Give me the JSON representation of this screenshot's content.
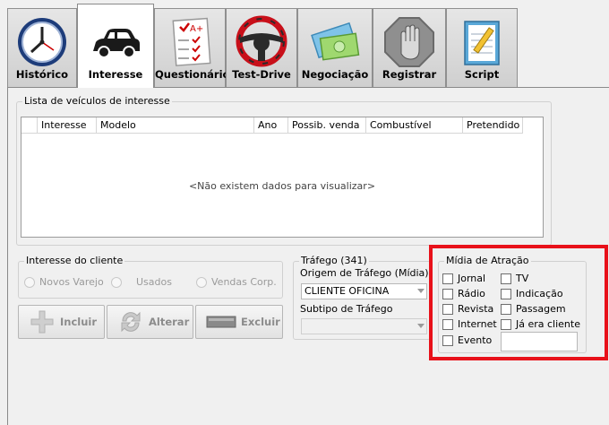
{
  "tabs": [
    {
      "label": "Histórico",
      "icon": "clock-icon"
    },
    {
      "label": "Interesse",
      "icon": "car-icon"
    },
    {
      "label": "Questionário",
      "icon": "checklist-icon"
    },
    {
      "label": "Test-Drive",
      "icon": "steering-wheel-icon"
    },
    {
      "label": "Negociação",
      "icon": "money-card-icon"
    },
    {
      "label": "Registrar",
      "icon": "stop-hand-icon"
    },
    {
      "label": "Script",
      "icon": "notepad-icon"
    }
  ],
  "active_tab": "Interesse",
  "vehicle_list": {
    "title": "Lista de veículos de interesse",
    "columns": [
      "Interesse",
      "Modelo",
      "Ano",
      "Possib. venda",
      "Combustível",
      "Pretendido"
    ],
    "empty_message": "<Não existem dados para visualizar>"
  },
  "client_interest": {
    "title": "Interesse do cliente",
    "options": [
      "Novos Varejo",
      "Usados",
      "Vendas Corp."
    ]
  },
  "actions": {
    "include": "Incluir",
    "change": "Alterar",
    "delete": "Excluir"
  },
  "traffic": {
    "title": "Tráfego (341)",
    "origin_label": "Origem de Tráfego (Mídia)",
    "origin_value": "CLIENTE OFICINA",
    "subtype_label": "Subtipo de Tráfego",
    "subtype_value": ""
  },
  "media": {
    "title": "Mídia de Atração",
    "left": [
      "Jornal",
      "Rádio",
      "Revista",
      "Internet",
      "Evento"
    ],
    "right": [
      "TV",
      "Indicação",
      "Passagem",
      "Já era cliente"
    ],
    "other_value": "",
    "highlight_color": "#e8111a"
  }
}
